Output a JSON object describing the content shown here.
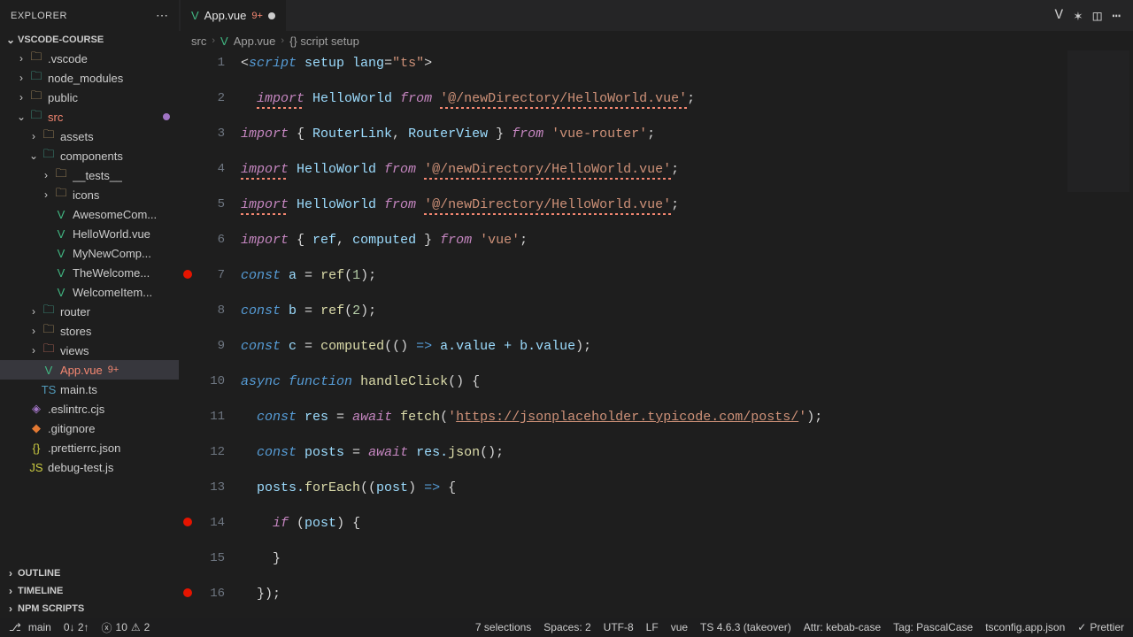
{
  "explorer": {
    "title": "EXPLORER",
    "project": "VSCODE-COURSE",
    "sections": {
      "outline": "OUTLINE",
      "timeline": "TIMELINE",
      "npm": "NPM SCRIPTS"
    },
    "tree": {
      "vscode": ".vscode",
      "node_modules": "node_modules",
      "public": "public",
      "src": "src",
      "assets": "assets",
      "components": "components",
      "tests": "__tests__",
      "icons": "icons",
      "awesome": "AwesomeCom...",
      "hello": "HelloWorld.vue",
      "mynew": "MyNewComp...",
      "thewelcome": "TheWelcome...",
      "welcomeitem": "WelcomeItem...",
      "router": "router",
      "stores": "stores",
      "views": "views",
      "app": "App.vue",
      "maints": "main.ts",
      "eslintrc": ".eslintrc.cjs",
      "gitignore": ".gitignore",
      "prettierrc": ".prettierrc.json",
      "debugtest": "debug-test.js"
    },
    "app_badge": "9+"
  },
  "tab": {
    "file": "App.vue",
    "problems": "9+"
  },
  "breadcrumb": {
    "src": "src",
    "file": "App.vue",
    "section": "{} script setup"
  },
  "code": {
    "l1": {
      "a": "<",
      "b": "script",
      "c": " setup",
      "d": " lang",
      "e": "=",
      "f": "\"ts\"",
      "g": ">"
    },
    "l2": {
      "a": "  ",
      "b": "import",
      "c": " HelloWorld ",
      "d": "from",
      "e": " ",
      "f": "'@/newDirectory/HelloWorld.vue'",
      "g": ";"
    },
    "l3": {
      "a": "import",
      "b": " { ",
      "c": "RouterLink",
      "d": ", ",
      "e": "RouterView",
      "f": " } ",
      "g": "from",
      "h": " ",
      "i": "'vue-router'",
      "j": ";"
    },
    "l4": {
      "a": "import",
      "b": " HelloWorld ",
      "c": "from",
      "d": " ",
      "e": "'@/newDirectory/HelloWorld.vue'",
      "f": ";"
    },
    "l5": {
      "a": "import",
      "b": " HelloWorld ",
      "c": "from",
      "d": " ",
      "e": "'@/newDirectory/HelloWorld.vue'",
      "f": ";"
    },
    "l6": {
      "a": "import",
      "b": " { ",
      "c": "ref",
      "d": ", ",
      "e": "computed",
      "f": " } ",
      "g": "from",
      "h": " ",
      "i": "'vue'",
      "j": ";"
    },
    "l7": {
      "a": "const",
      "b": " a ",
      "c": "=",
      "d": " ",
      "e": "ref",
      "f": "(",
      "g": "1",
      "h": ");"
    },
    "l8": {
      "a": "const",
      "b": " b ",
      "c": "=",
      "d": " ",
      "e": "ref",
      "f": "(",
      "g": "2",
      "h": ");"
    },
    "l9": {
      "a": "const",
      "b": " c ",
      "c": "=",
      "d": " ",
      "e": "computed",
      "f": "(() ",
      "g": "=>",
      "h": " a.",
      "i": "value",
      "j": " + b.",
      "k": "value",
      "l": ");"
    },
    "l10": {
      "a": "async",
      "b": " ",
      "c": "function",
      "d": " ",
      "e": "handleClick",
      "f": "() {"
    },
    "l11": {
      "a": "  ",
      "b": "const",
      "c": " res ",
      "d": "=",
      "e": " ",
      "f": "await",
      "g": " ",
      "h": "fetch",
      "i": "(",
      "j": "'",
      "k": "https://jsonplaceholder.typicode.com/posts/",
      "l": "'",
      "m": ");"
    },
    "l12": {
      "a": "  ",
      "b": "const",
      "c": " posts ",
      "d": "=",
      "e": " ",
      "f": "await",
      "g": " res.",
      "h": "json",
      "i": "();"
    },
    "l13": {
      "a": "  posts.",
      "b": "forEach",
      "c": "((",
      "d": "post",
      "e": ") ",
      "f": "=>",
      "g": " {"
    },
    "l14": {
      "a": "    ",
      "b": "if",
      "c": " (",
      "d": "post",
      "e": ") {"
    },
    "l15": {
      "a": "    }"
    },
    "l16": {
      "a": "  });"
    }
  },
  "line_numbers": {
    "n1": "1",
    "n2": "2",
    "n3": "3",
    "n4": "4",
    "n5": "5",
    "n6": "6",
    "n7": "7",
    "n8": "8",
    "n9": "9",
    "n10": "10",
    "n11": "11",
    "n12": "12",
    "n13": "13",
    "n14": "14",
    "n15": "15",
    "n16": "16"
  },
  "status": {
    "branch": "main",
    "sync": "0↓ 2↑",
    "errors": "10",
    "warnings": "2",
    "selections": "7 selections",
    "spaces": "Spaces: 2",
    "encoding": "UTF-8",
    "eol": "LF",
    "lang": "vue",
    "ts": "TS 4.6.3 (takeover)",
    "attr": "Attr: kebab-case",
    "tag": "Tag: PascalCase",
    "tsconfig": "tsconfig.app.json",
    "prettier": "Prettier"
  }
}
